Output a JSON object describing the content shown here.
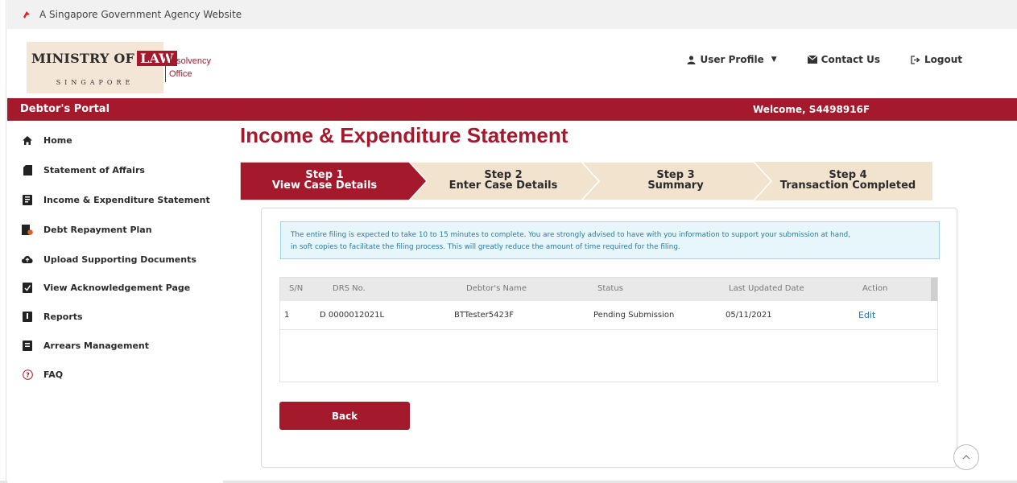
{
  "gov_bar": {
    "text": "A Singapore Government Agency Website"
  },
  "logo": {
    "ministry": "Ministry of",
    "law": "Law",
    "country": "SINGAPORE",
    "office_line1": "Insolvency",
    "office_line2": "Office"
  },
  "top_nav": {
    "user_profile": "User Profile",
    "contact_us": "Contact Us",
    "logout": "Logout"
  },
  "portal_bar": {
    "title": "Debtor's Portal",
    "welcome": "Welcome, S4498916F"
  },
  "sidebar": {
    "items": [
      {
        "label": "Home",
        "icon": "home-icon"
      },
      {
        "label": "Statement of Affairs",
        "icon": "document-icon"
      },
      {
        "label": "Income & Expenditure Statement",
        "icon": "ledger-icon"
      },
      {
        "label": "Debt Repayment Plan",
        "icon": "repayment-icon"
      },
      {
        "label": "Upload Supporting Documents",
        "icon": "cloud-upload-icon"
      },
      {
        "label": "View Acknowledgement Page",
        "icon": "acknowledgement-icon"
      },
      {
        "label": "Reports",
        "icon": "report-icon"
      },
      {
        "label": "Arrears Management",
        "icon": "arrears-icon"
      },
      {
        "label": "FAQ",
        "icon": "question-icon"
      }
    ]
  },
  "page": {
    "title": "Income & Expenditure Statement"
  },
  "steps": [
    {
      "line1": "Step 1",
      "line2": "View Case Details",
      "active": true
    },
    {
      "line1": "Step 2",
      "line2": "Enter Case Details",
      "active": false
    },
    {
      "line1": "Step 3",
      "line2": "Summary",
      "active": false
    },
    {
      "line1": "Step 4",
      "line2": "Transaction Completed",
      "active": false
    }
  ],
  "info": {
    "line1": "The entire filing is expected to take 10 to 15 minutes to complete. You are strongly advised to have with you information to support your submission at hand,",
    "line2": "in soft copies to facilitate the filing process. This will greatly reduce the amount of time required for the filing."
  },
  "table": {
    "headers": [
      "S/N",
      "DRS No.",
      "Debtor's Name",
      "Status",
      "Last Updated Date",
      "Action"
    ],
    "rows": [
      {
        "sn": "1",
        "drs": "D 0000012021L",
        "name": "BTTester5423F",
        "status": "Pending Submission",
        "date": "05/11/2021",
        "action": "Edit"
      }
    ]
  },
  "buttons": {
    "back": "Back"
  },
  "colors": {
    "brand": "#a5192c",
    "step_inactive": "#f2e3cf",
    "info_bg": "#e6f6fb",
    "link": "#1a73c9"
  }
}
